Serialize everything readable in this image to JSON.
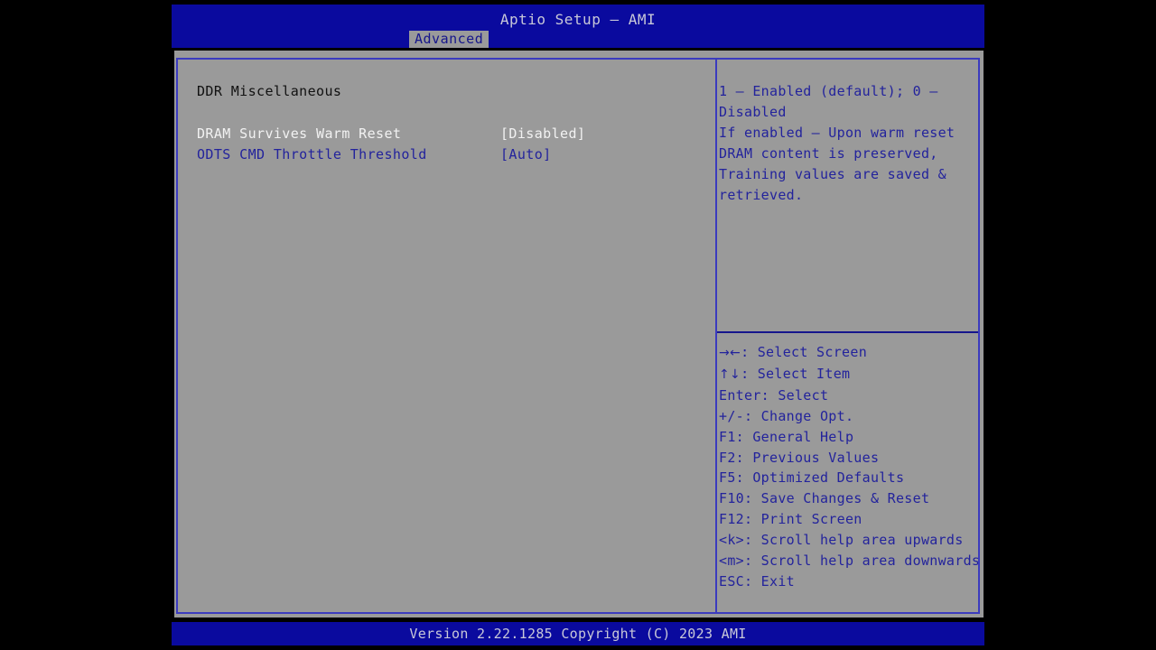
{
  "app": {
    "title": "Aptio Setup – AMI",
    "version_text": "Version 2.22.1285 Copyright (C) 2023 AMI"
  },
  "colors": {
    "title_bar_blue": "#0a0a9e",
    "panel_gray": "#9a9a9a",
    "border_blue": "#3b3bbe",
    "text_blue": "#23239c",
    "text_selected": "#f2f2f2",
    "text_heading": "#111111"
  },
  "tabs": [
    {
      "label": "Advanced",
      "active": true
    }
  ],
  "left_pane": {
    "section_heading": "DDR Miscellaneous",
    "settings": [
      {
        "label": "DRAM Survives Warm Reset",
        "value": "[Disabled]",
        "selected": true
      },
      {
        "label": "ODTS CMD Throttle Threshold",
        "value": "[Auto]",
        "selected": false
      }
    ]
  },
  "right_pane": {
    "help_lines": [
      "1 – Enabled (default); 0 –",
      "Disabled",
      "If enabled – Upon warm reset",
      "DRAM content is preserved,",
      "Training values are saved &",
      "retrieved."
    ],
    "key_legend": [
      {
        "glyph": "→←",
        "text": ": Select Screen"
      },
      {
        "glyph": "↑↓",
        "text": ": Select Item"
      },
      {
        "glyph": "",
        "text": "Enter: Select"
      },
      {
        "glyph": "",
        "text": "+/-: Change Opt."
      },
      {
        "glyph": "",
        "text": "F1: General Help"
      },
      {
        "glyph": "",
        "text": "F2: Previous Values"
      },
      {
        "glyph": "",
        "text": "F5: Optimized Defaults"
      },
      {
        "glyph": "",
        "text": "F10: Save Changes & Reset"
      },
      {
        "glyph": "",
        "text": "F12: Print Screen"
      },
      {
        "glyph": "",
        "text": "<k>: Scroll help area upwards"
      },
      {
        "glyph": "",
        "text": "<m>: Scroll help area downwards"
      },
      {
        "glyph": "",
        "text": "ESC: Exit"
      }
    ]
  }
}
